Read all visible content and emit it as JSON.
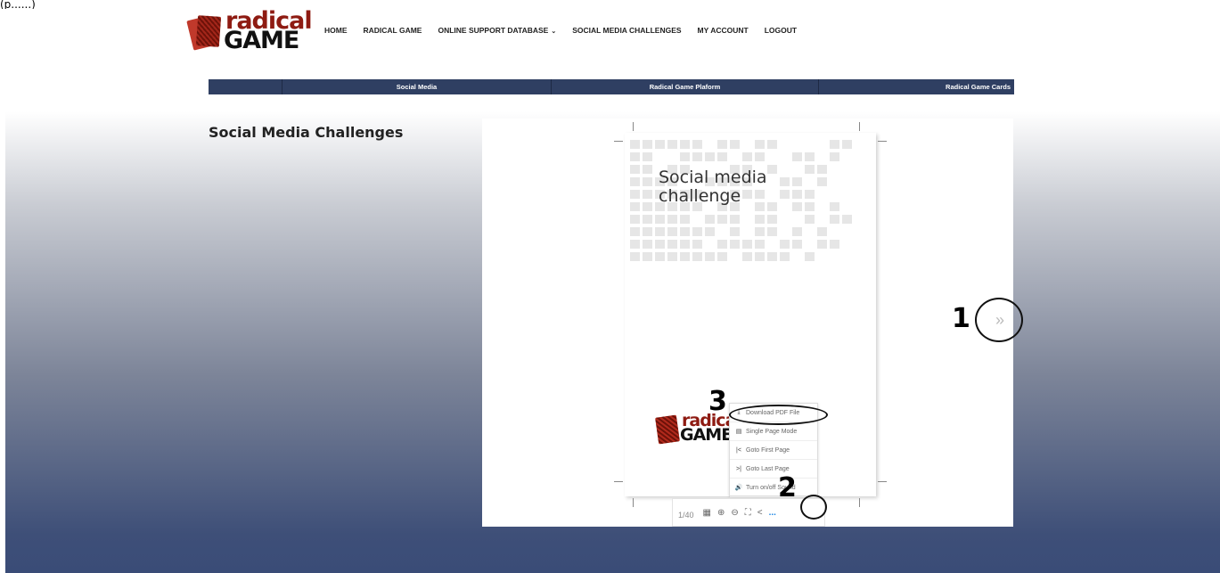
{
  "top_crop_text": "(p......)",
  "logo": {
    "line1": "radical",
    "line2": "GAME"
  },
  "nav": {
    "items": [
      {
        "label": "HOME"
      },
      {
        "label": "RADICAL GAME"
      },
      {
        "label": "ONLINE SUPPORT DATABASE",
        "dropdown": "⌄"
      },
      {
        "label": "SOCIAL MEDIA CHALLENGES"
      },
      {
        "label": "MY ACCOUNT"
      },
      {
        "label": "LOGOUT"
      }
    ]
  },
  "subnav": {
    "cells": [
      "",
      "Social Media",
      "Radical Game Plaform",
      "Radical Game Cards"
    ]
  },
  "page_title": "Social Media Challenges",
  "viewer": {
    "doc_title_line1": "Social media",
    "doc_title_line2": "challenge",
    "doc_logo_line1": "radical",
    "doc_logo_line2": "GAME",
    "menu": [
      {
        "icon": "download-icon",
        "glyph": "⤓",
        "label": "Download PDF File"
      },
      {
        "icon": "page-icon",
        "glyph": "▤",
        "label": "Single Page Mode"
      },
      {
        "icon": "first-page-icon",
        "glyph": "|<",
        "label": "Goto First Page"
      },
      {
        "icon": "last-page-icon",
        "glyph": ">|",
        "label": "Goto Last Page"
      },
      {
        "icon": "sound-icon",
        "glyph": "🔊",
        "label": "Turn on/off Sound"
      }
    ],
    "toolbar": {
      "page_indicator": "1/40",
      "grid_glyph": "▦",
      "zoom_in_glyph": "⊕",
      "zoom_out_glyph": "⊖",
      "fullscreen_glyph": "⛶",
      "share_glyph": "<",
      "more_glyph": "..."
    },
    "next_glyph": "»"
  },
  "annotations": {
    "one": "1",
    "two": "2",
    "three": "3"
  },
  "colors": {
    "navy": "#2f3f62",
    "brand_red": "#8e1b12",
    "link_blue": "#1e88e5"
  }
}
